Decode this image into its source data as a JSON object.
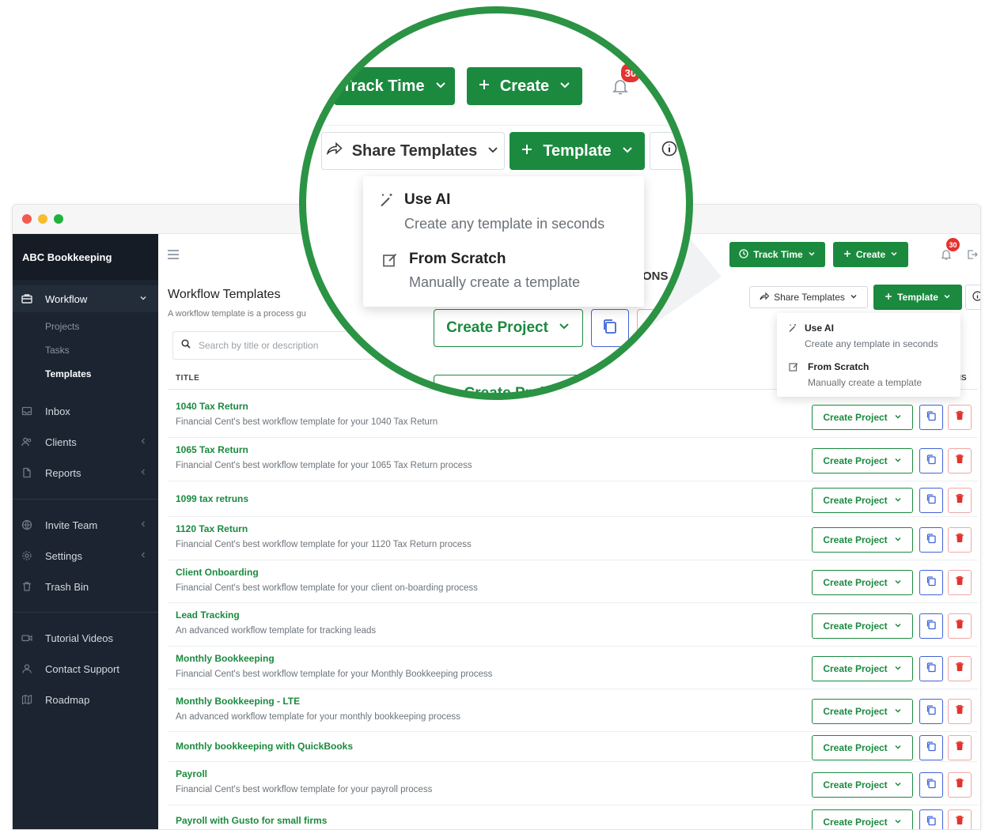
{
  "app": {
    "brand": "ABC Bookkeeping"
  },
  "sidebar": {
    "workflow": "Workflow",
    "sub": [
      "Projects",
      "Tasks",
      "Templates"
    ],
    "items": [
      "Inbox",
      "Clients",
      "Reports",
      "Invite Team",
      "Settings",
      "Trash Bin",
      "Tutorial Videos",
      "Contact Support",
      "Roadmap"
    ]
  },
  "header": {
    "track_time": "Track Time",
    "create": "Create",
    "notification_count": "30",
    "lens_notification_count": "30"
  },
  "toolbar": {
    "share_templates": "Share Templates",
    "template": "Template"
  },
  "dropdown": {
    "use_ai_title": "Use AI",
    "use_ai_desc": "Create any template in seconds",
    "scratch_title": "From Scratch",
    "scratch_desc": "Manually create a template"
  },
  "page": {
    "title": "Workflow Templates",
    "subtitle": "A workflow template is a process gu",
    "search_placeholder": "Search by title or description",
    "col_title": "TITLE",
    "col_actions": "ONS",
    "lens_col_actions": "ONS"
  },
  "row_action": "Create Project",
  "lens_create_project": "Create Project",
  "lens_create_project_partial": "Create Proje",
  "templates": [
    {
      "title": "1040 Tax Return",
      "desc": "Financial Cent's best workflow template for your 1040 Tax Return"
    },
    {
      "title": "1065 Tax Return",
      "desc": "Financial Cent's best workflow template for your 1065 Tax Return process"
    },
    {
      "title": "1099 tax retruns",
      "desc": ""
    },
    {
      "title": "1120 Tax Return",
      "desc": "Financial Cent's best workflow template for your 1120 Tax Return process"
    },
    {
      "title": "Client Onboarding",
      "desc": "Financial Cent's best workflow template for your client on-boarding process"
    },
    {
      "title": "Lead Tracking",
      "desc": "An advanced workflow template for tracking leads"
    },
    {
      "title": "Monthly Bookkeeping",
      "desc": "Financial Cent's best workflow template for your Monthly Bookkeeping process"
    },
    {
      "title": "Monthly Bookkeeping - LTE",
      "desc": "An advanced workflow template for your monthly bookkeeping process"
    },
    {
      "title": "Monthly bookkeeping with QuickBooks",
      "desc": ""
    },
    {
      "title": "Payroll",
      "desc": "Financial Cent's best workflow template for your payroll process"
    },
    {
      "title": "Payroll with Gusto for small firms",
      "desc": ""
    }
  ],
  "colors": {
    "green": "#1b8a3f",
    "ring": "#2b9344",
    "sidebar": "#1b2430",
    "danger": "#e5322d",
    "copy": "#3f63d8"
  },
  "icons": [
    "briefcase-icon",
    "inbox-icon",
    "users-icon",
    "file-icon",
    "globe-icon",
    "gear-icon",
    "trash-icon",
    "video-icon",
    "person-icon",
    "map-icon",
    "bell-icon",
    "logout-icon",
    "info-icon",
    "search-icon",
    "magic-wand-icon",
    "edit-icon",
    "copy-icon",
    "share-icon",
    "clock-icon",
    "plus-icon",
    "chevron-down-icon"
  ]
}
